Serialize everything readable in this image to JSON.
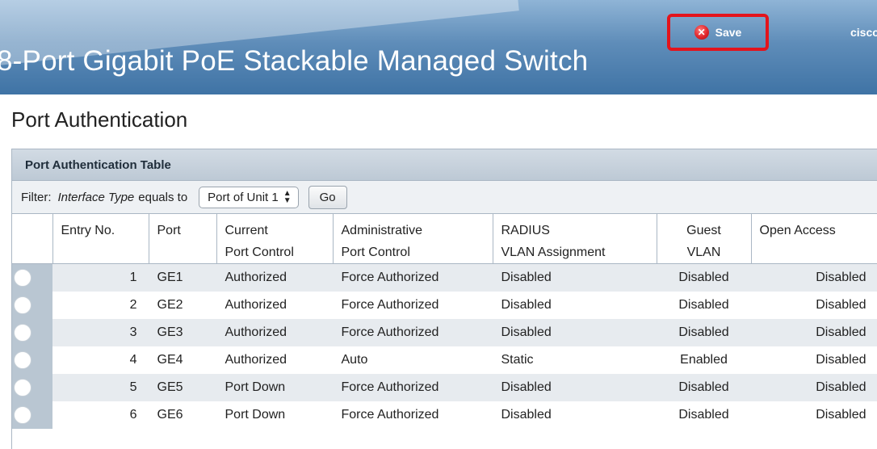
{
  "header": {
    "product_title": "8-Port Gigabit PoE Stackable Managed Switch",
    "save_label": "Save",
    "brand_text": "cisco"
  },
  "page": {
    "title": "Port Authentication"
  },
  "table": {
    "caption": "Port Authentication Table",
    "filter": {
      "label": "Filter:",
      "field": "Interface Type",
      "operator": "equals to",
      "selected_value": "Port of Unit 1",
      "go_label": "Go"
    },
    "columns": [
      {
        "line1": "",
        "line2": ""
      },
      {
        "line1": "Entry No.",
        "line2": ""
      },
      {
        "line1": "Port",
        "line2": ""
      },
      {
        "line1": "Current",
        "line2": "Port Control"
      },
      {
        "line1": "Administrative",
        "line2": "Port Control"
      },
      {
        "line1": "RADIUS",
        "line2": "VLAN Assignment"
      },
      {
        "line1": "Guest",
        "line2": "VLAN"
      },
      {
        "line1": "Open Access",
        "line2": ""
      }
    ],
    "rows": [
      {
        "entry": "1",
        "port": "GE1",
        "current": "Authorized",
        "admin": "Force Authorized",
        "radius": "Disabled",
        "guest": "Disabled",
        "open": "Disabled"
      },
      {
        "entry": "2",
        "port": "GE2",
        "current": "Authorized",
        "admin": "Force Authorized",
        "radius": "Disabled",
        "guest": "Disabled",
        "open": "Disabled"
      },
      {
        "entry": "3",
        "port": "GE3",
        "current": "Authorized",
        "admin": "Force Authorized",
        "radius": "Disabled",
        "guest": "Disabled",
        "open": "Disabled"
      },
      {
        "entry": "4",
        "port": "GE4",
        "current": "Authorized",
        "admin": "Auto",
        "radius": "Static",
        "guest": "Enabled",
        "open": "Disabled"
      },
      {
        "entry": "5",
        "port": "GE5",
        "current": "Port Down",
        "admin": "Force Authorized",
        "radius": "Disabled",
        "guest": "Disabled",
        "open": "Disabled"
      },
      {
        "entry": "6",
        "port": "GE6",
        "current": "Port Down",
        "admin": "Force Authorized",
        "radius": "Disabled",
        "guest": "Disabled",
        "open": "Disabled"
      }
    ]
  },
  "colors": {
    "header_blue": "#3f73a5",
    "highlight_red": "#e3141c",
    "row_alt": "#e7ebef"
  }
}
